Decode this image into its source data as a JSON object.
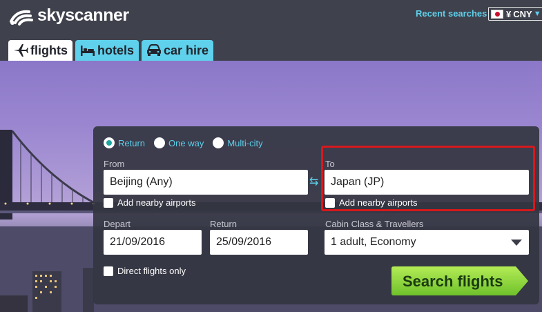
{
  "brand": {
    "name": "skyscanner"
  },
  "header": {
    "recent_searches": "Recent searches",
    "currency": {
      "symbol": "¥",
      "code": "CNY"
    }
  },
  "tabs": [
    {
      "label": "flights",
      "icon": "plane-icon",
      "active": true
    },
    {
      "label": "hotels",
      "icon": "bed-icon",
      "active": false
    },
    {
      "label": "car hire",
      "icon": "car-icon",
      "active": false
    }
  ],
  "search": {
    "trip_types": [
      {
        "label": "Return",
        "checked": true
      },
      {
        "label": "One way",
        "checked": false
      },
      {
        "label": "Multi-city",
        "checked": false
      }
    ],
    "from_label": "From",
    "from_value": "Beijing (Any)",
    "from_nearby": "Add nearby airports",
    "to_label": "To",
    "to_value": "Japan (JP)",
    "to_nearby": "Add nearby airports",
    "depart_label": "Depart",
    "depart_value": "21/09/2016",
    "return_label": "Return",
    "return_value": "25/09/2016",
    "cabin_label": "Cabin Class & Travellers",
    "cabin_value": "1 adult, Economy",
    "direct_only": "Direct flights only",
    "submit": "Search flights"
  },
  "colors": {
    "accent": "#5ecfe9",
    "highlight": "#d7191c",
    "button": "#8ad83a"
  }
}
